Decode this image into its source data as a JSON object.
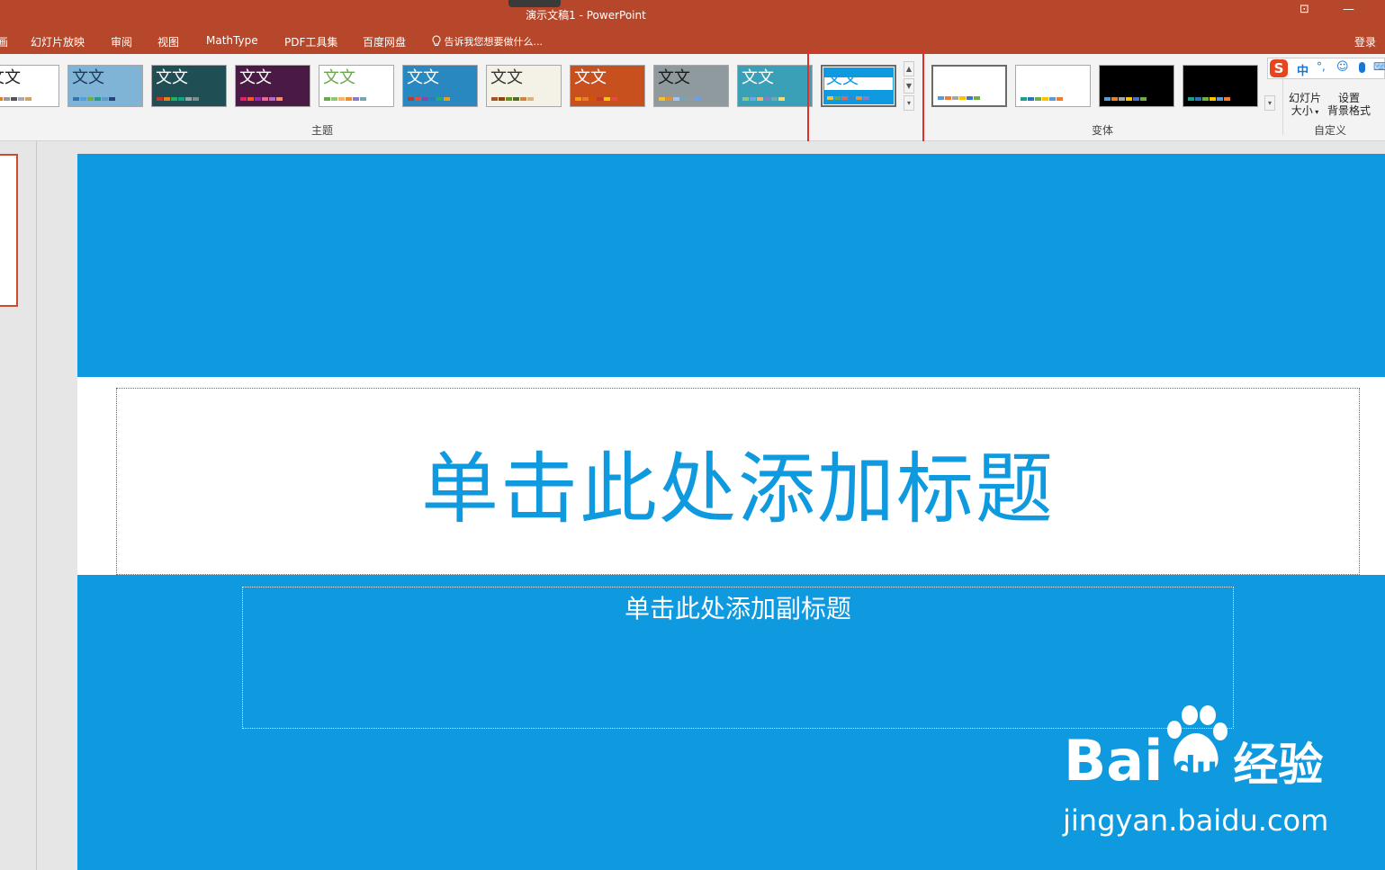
{
  "window": {
    "title": "演示文稿1 - PowerPoint",
    "restore_glyph": "⊡",
    "minimize_glyph": "—"
  },
  "menu": {
    "items": [
      "画",
      "幻灯片放映",
      "审阅",
      "视图",
      "MathType",
      "PDF工具集",
      "百度网盘"
    ],
    "tell_me": "告诉我您想要做什么...",
    "login": "登录"
  },
  "ribbon": {
    "themes_label": "主题",
    "variants_label": "变体",
    "customize_label": "自定义",
    "theme_sample_text": "文文",
    "selected_theme_index": 10,
    "themes": [
      {
        "bg": "#ffffff",
        "fg": "#222222",
        "swatches": [
          "#f1c232",
          "#d9822b",
          "#999999",
          "#555555",
          "#aaaaaa",
          "#c9a66b"
        ]
      },
      {
        "bg": "#7fb4d6",
        "fg": "#1b3b5a",
        "swatches": [
          "#2e75b6",
          "#4aa3df",
          "#70ad47",
          "#1f9c8c",
          "#5b9bd5",
          "#264478"
        ]
      },
      {
        "bg": "#1f4e54",
        "fg": "#ffffff",
        "swatches": [
          "#c0392b",
          "#e67e22",
          "#27ae60",
          "#16a085",
          "#95a5a6",
          "#7f8c8d"
        ]
      },
      {
        "bg": "#4a1a45",
        "fg": "#ffffff",
        "swatches": [
          "#e91e63",
          "#ff5722",
          "#9c27b0",
          "#f06292",
          "#ba68c8",
          "#ff8a65"
        ]
      },
      {
        "bg": "#ffffff",
        "fg": "#6aa84f",
        "swatches": [
          "#6aa84f",
          "#93c47d",
          "#f6b26b",
          "#e69138",
          "#8e7cc3",
          "#76a5af"
        ]
      },
      {
        "bg": "#2a88c0",
        "fg": "#ffffff",
        "swatches": [
          "#c0392b",
          "#e74c3c",
          "#8e44ad",
          "#2980b9",
          "#27ae60",
          "#f39c12"
        ]
      },
      {
        "bg": "#f4f1e6",
        "fg": "#333333",
        "swatches": [
          "#a0522d",
          "#8b4513",
          "#6b8e23",
          "#556b2f",
          "#cd853f",
          "#d2b48c"
        ]
      },
      {
        "bg": "#c8501e",
        "fg": "#ffffff",
        "swatches": [
          "#f39c12",
          "#e67e22",
          "#d35400",
          "#c0392b",
          "#f1c40f",
          "#e74c3c"
        ]
      },
      {
        "bg": "#8f9a9e",
        "fg": "#1a1a1a",
        "swatches": [
          "#f1c232",
          "#e69138",
          "#a4c2f4",
          "#76a5af",
          "#999999",
          "#6d9eeb"
        ]
      },
      {
        "bg": "#3aa0b8",
        "fg": "#ffffff",
        "swatches": [
          "#93c47d",
          "#6fa8dc",
          "#f6b26b",
          "#8e7cc3",
          "#76a5af",
          "#ffd966"
        ]
      },
      {
        "bg": "#0f9ae0",
        "fg": "#0f9ae0",
        "swatches": [
          "#f1c232",
          "#6aa84f",
          "#e06666",
          "#3d85c6",
          "#e69138",
          "#8e7cc3"
        ]
      }
    ],
    "variants": [
      {
        "bg": "#ffffff",
        "swatches": [
          "#5b9bd5",
          "#ed7d31",
          "#a5a5a5",
          "#ffc000",
          "#4472c4",
          "#70ad47"
        ]
      },
      {
        "bg": "#ffffff",
        "swatches": [
          "#1f9c8c",
          "#2e75b6",
          "#70ad47",
          "#ffc000",
          "#5b9bd5",
          "#ed7d31"
        ]
      },
      {
        "bg": "#000000",
        "swatches": [
          "#5b9bd5",
          "#ed7d31",
          "#a5a5a5",
          "#ffc000",
          "#4472c4",
          "#70ad47"
        ]
      },
      {
        "bg": "#000000",
        "swatches": [
          "#1f9c8c",
          "#2e75b6",
          "#70ad47",
          "#ffc000",
          "#5b9bd5",
          "#ed7d31"
        ]
      }
    ],
    "slide_size_label_1": "幻灯片",
    "slide_size_label_2": "大小",
    "bg_format_label_1": "设置",
    "bg_format_label_2": "背景格式",
    "scroll_up": "▲",
    "scroll_down": "▼",
    "scroll_more": "▾"
  },
  "ime": {
    "logo": "S",
    "mode": "中",
    "punct": "°,",
    "emoji": "☺",
    "mic": "🎤",
    "kbd": "⌨"
  },
  "slide": {
    "title_placeholder": "单击此处添加标题",
    "subtitle_placeholder": "单击此处添加副标题",
    "bg_color": "#0f9ae0"
  },
  "watermark": {
    "brand": "Bai",
    "brand_tail": "du",
    "cn": "经验",
    "url": "jingyan.baidu.com"
  }
}
